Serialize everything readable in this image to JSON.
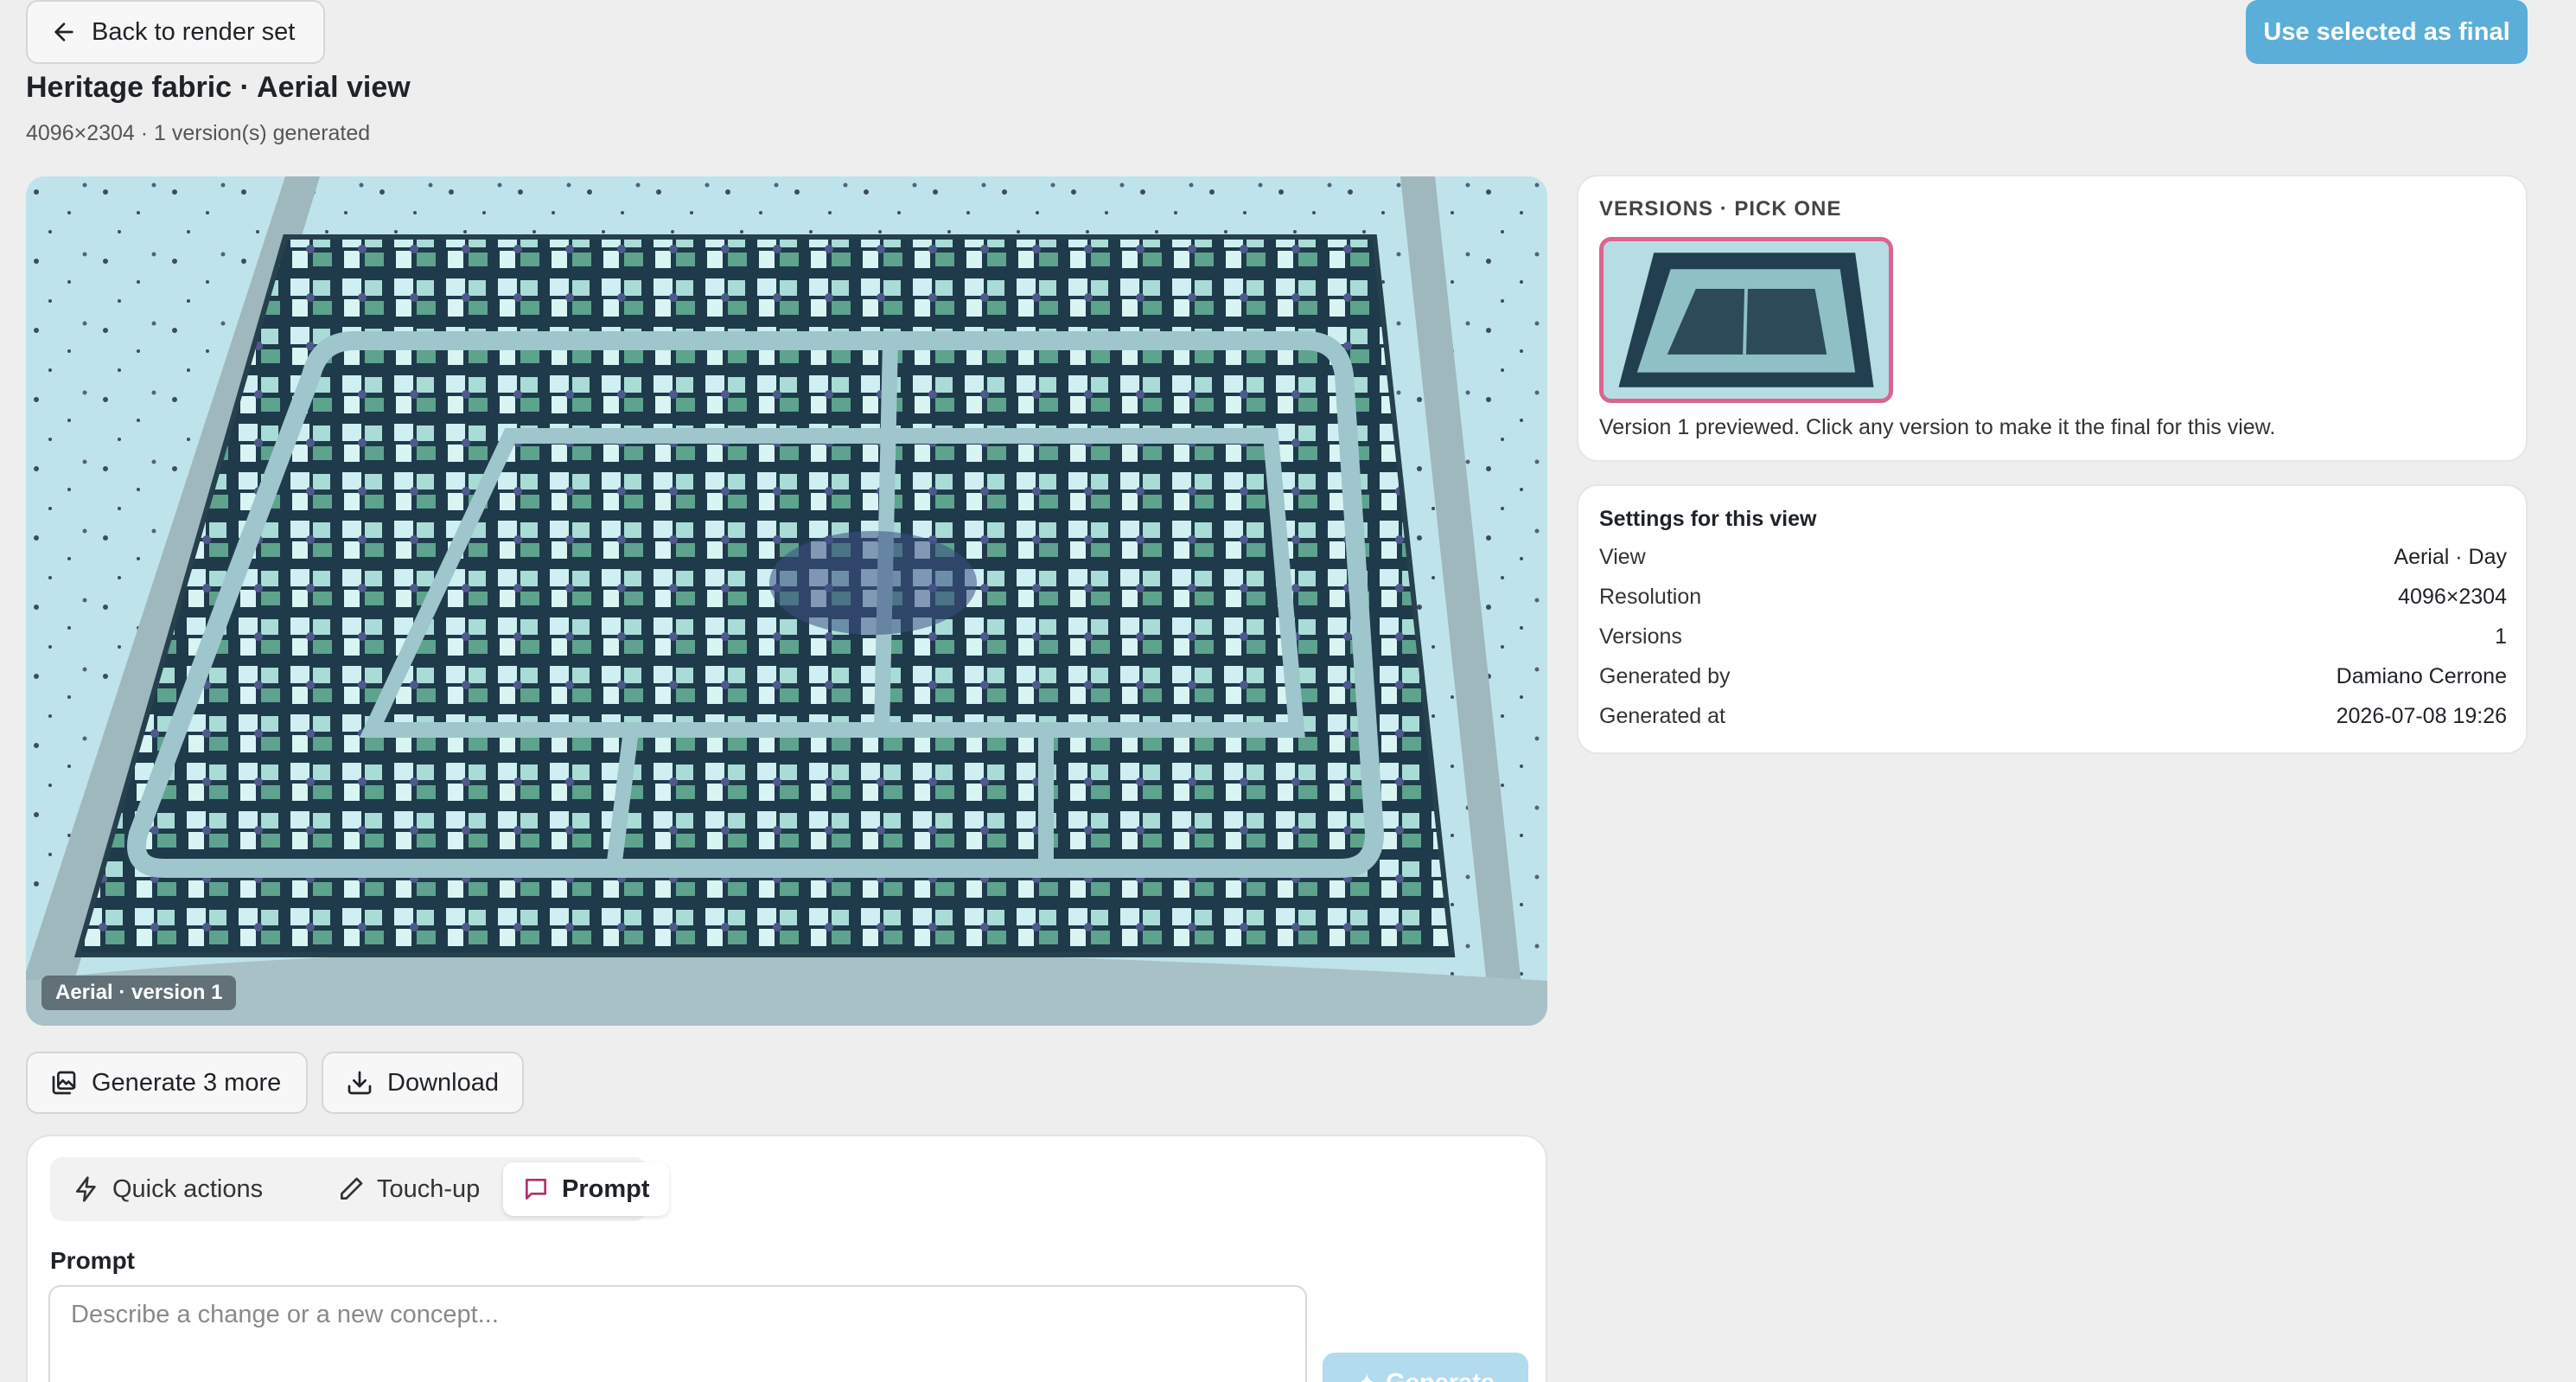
{
  "header": {
    "back_label": "Back to render set",
    "final_label": "Use selected as final",
    "title": "Heritage fabric · Aerial view",
    "subtitle": "4096×2304 · 1 version(s) generated"
  },
  "preview": {
    "badge": "Aerial · version 1"
  },
  "actions": {
    "generate_more": "Generate 3 more",
    "download": "Download"
  },
  "edit": {
    "tabs": [
      {
        "label": "Quick actions",
        "icon": "lightning-icon"
      },
      {
        "label": "Touch-up",
        "icon": "pencil-icon"
      },
      {
        "label": "Prompt",
        "icon": "chat-bubble-icon",
        "active": true
      }
    ],
    "prompt_label": "Prompt",
    "prompt_placeholder": "Describe a change or a new concept...",
    "generate_label": "Generate"
  },
  "versions": {
    "title": "VERSIONS · PICK ONE",
    "note": "Version 1 previewed. Click any version to make it the final for this view.",
    "items": [
      {
        "label": "Version 1",
        "selected": true
      }
    ]
  },
  "settings": {
    "title": "Settings for this view",
    "rows": [
      {
        "key": "View",
        "value": "Aerial · Day"
      },
      {
        "key": "Resolution",
        "value": "4096×2304"
      },
      {
        "key": "Versions",
        "value": "1"
      },
      {
        "key": "Generated by",
        "value": "Damiano Cerrone"
      },
      {
        "key": "Generated at",
        "value": "2026-07-08 19:26"
      }
    ]
  },
  "colors": {
    "accent": "#5aaed8",
    "selected_border": "#d9658e",
    "map_ground": "#b9dfe6"
  }
}
